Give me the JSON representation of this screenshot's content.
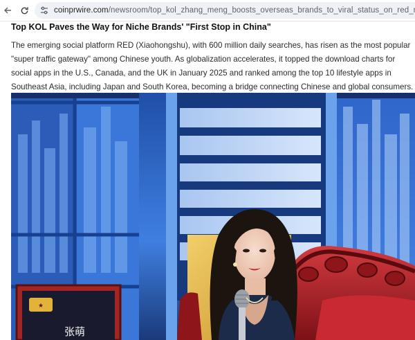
{
  "browser": {
    "url_domain": "coinprwire.com",
    "url_path": "/newsroom/top_kol_zhang_meng_boosts_overseas_brands_to_viral_status_on_red_note_xiaohongshu_help"
  },
  "article": {
    "headline": "Top KOL Paves the Way for Niche Brands' \"First Stop in China\"",
    "paragraph": "The emerging social platform RED (Xiaohongshu), with 600 million daily searches, has risen as the most popular \"super traffic gateway\" among Chinese youth. As globalization accelerates, it topped the download charts for social apps in the U.S., Canada, and the UK in January 2025 and ranked among the top 10 lifestyle apps in Southeast Asia, including Japan and South Korea, becoming a bridge connecting Chinese and global consumers."
  },
  "photo": {
    "nameplate_text": "张萌"
  },
  "colors": {
    "stage_blue": "#2f6fd6",
    "stage_gold": "#e7b84a",
    "chair_red": "#b4202a",
    "dress_navy": "#1c2b4a"
  }
}
